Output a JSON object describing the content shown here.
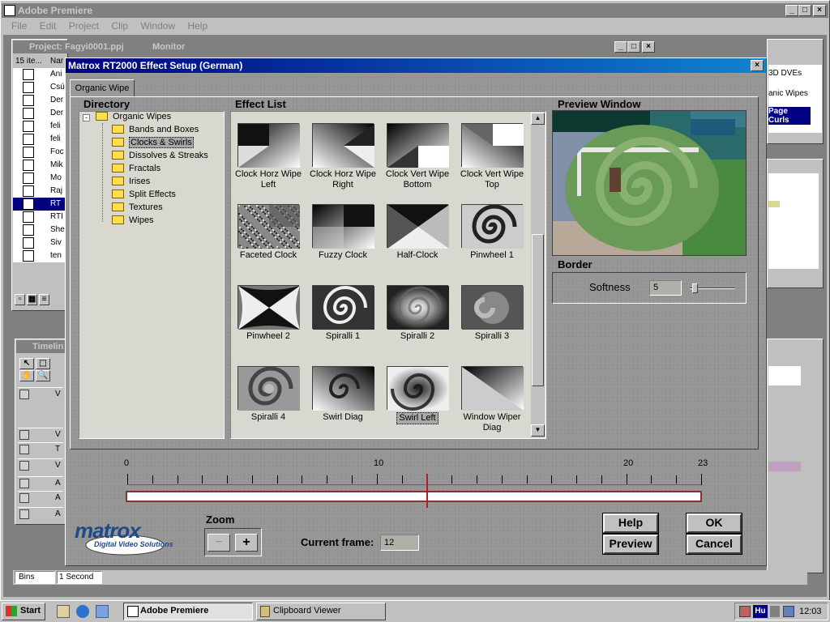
{
  "app": {
    "title": "Adobe Premiere",
    "menu": [
      "File",
      "Edit",
      "Project",
      "Clip",
      "Window",
      "Help"
    ]
  },
  "project": {
    "title": "Project: Fagyi0001.ppj",
    "count": "15 ite...",
    "col_name": "Nar",
    "items": [
      "Ani",
      "Csú",
      "Der",
      "Der",
      "feli",
      "feli",
      "Foc",
      "Mik",
      "Mo",
      "Raj",
      "RT",
      "RTI",
      "She",
      "Siv",
      "ten"
    ],
    "selected_index": 10
  },
  "monitor": {
    "title": "Monitor"
  },
  "timeline": {
    "title": "Timelin",
    "tracks": [
      "V",
      "V",
      "T",
      "V",
      "A",
      "A",
      "A"
    ]
  },
  "right_panel": {
    "items": [
      "3D DVEs",
      "anic Wipes",
      "Page Curls"
    ]
  },
  "bottom_bar": {
    "bins": "Bins",
    "duration": "1 Second"
  },
  "dialog": {
    "title": "Matrox RT2000 Effect Setup (German)",
    "tab": "Organic Wipe",
    "directory_heading": "Directory",
    "effect_list_heading": "Effect List",
    "preview_heading": "Preview Window",
    "border_heading": "Border",
    "softness_label": "Softness",
    "softness_value": "5",
    "softness_level": 0.05,
    "tree": {
      "root": "Organic Wipes",
      "children": [
        "Bands and Boxes",
        "Clocks & Swirls",
        "Dissolves & Streaks",
        "Fractals",
        "Irises",
        "Split Effects",
        "Textures",
        "Wipes"
      ],
      "selected": "Clocks & Swirls"
    },
    "effects": [
      {
        "label": "Clock Horz Wipe Left",
        "pattern": "clock-left"
      },
      {
        "label": "Clock Horz Wipe Right",
        "pattern": "clock-right"
      },
      {
        "label": "Clock Vert Wipe Bottom",
        "pattern": "clock-bottom"
      },
      {
        "label": "Clock Vert Wipe Top",
        "pattern": "clock-top"
      },
      {
        "label": "Faceted Clock",
        "pattern": "noise"
      },
      {
        "label": "Fuzzy Clock",
        "pattern": "fuzzy"
      },
      {
        "label": "Half-Clock",
        "pattern": "half"
      },
      {
        "label": "Pinwheel 1",
        "pattern": "pinwheel1"
      },
      {
        "label": "Pinwheel 2",
        "pattern": "pinwheel2"
      },
      {
        "label": "Spiralli 1",
        "pattern": "spiral1"
      },
      {
        "label": "Spiralli 2",
        "pattern": "spiral2"
      },
      {
        "label": "Spiralli 3",
        "pattern": "spiral3"
      },
      {
        "label": "Spiralli 4",
        "pattern": "spiral4"
      },
      {
        "label": "Swirl Diag",
        "pattern": "swirldiag"
      },
      {
        "label": "Swirl Left",
        "pattern": "swirlleft"
      },
      {
        "label": "Window Wiper Diag",
        "pattern": "wiper"
      }
    ],
    "selected_effect": "Swirl Left",
    "ruler": {
      "labels": [
        "0",
        "10",
        "20",
        "23"
      ],
      "current_marker": 12
    },
    "zoom_label": "Zoom",
    "zoom_minus": "−",
    "zoom_plus": "+",
    "current_frame_label": "Current frame:",
    "current_frame_value": "12",
    "logo_text": "matrox",
    "logo_sub": "Digital Video Solutions",
    "buttons": {
      "help": "Help",
      "ok": "OK",
      "preview": "Preview",
      "cancel": "Cancel"
    }
  },
  "taskbar": {
    "start": "Start",
    "tasks": [
      "Adobe Premiere",
      "Clipboard Viewer"
    ],
    "lang": "Hu",
    "time": "12:03"
  }
}
